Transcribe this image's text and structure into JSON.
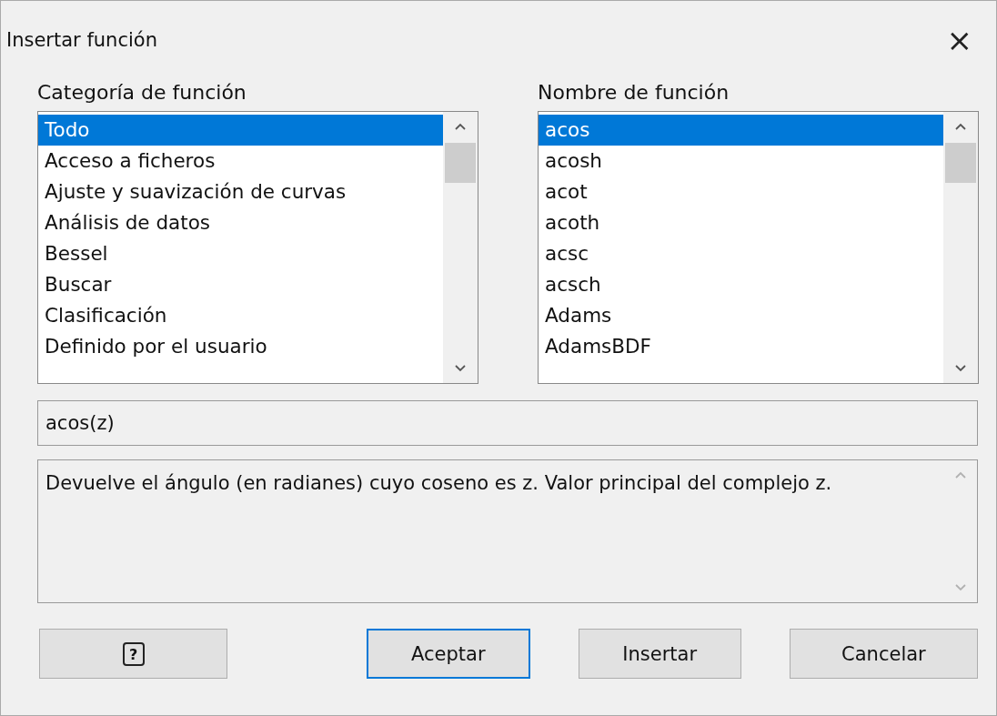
{
  "window": {
    "title": "Insertar función",
    "close": "×"
  },
  "category_list": {
    "label": "Categoría de función",
    "items": [
      {
        "label": "Todo",
        "selected": true
      },
      {
        "label": "Acceso a ficheros",
        "selected": false
      },
      {
        "label": "Ajuste y suavización de curvas",
        "selected": false
      },
      {
        "label": "Análisis de datos",
        "selected": false
      },
      {
        "label": "Bessel",
        "selected": false
      },
      {
        "label": "Buscar",
        "selected": false
      },
      {
        "label": "Clasificación",
        "selected": false
      },
      {
        "label": "Definido por el usuario",
        "selected": false
      }
    ]
  },
  "function_list": {
    "label": "Nombre de función",
    "items": [
      {
        "label": "acos",
        "selected": true
      },
      {
        "label": "acosh",
        "selected": false
      },
      {
        "label": "acot",
        "selected": false
      },
      {
        "label": "acoth",
        "selected": false
      },
      {
        "label": "acsc",
        "selected": false
      },
      {
        "label": "acsch",
        "selected": false
      },
      {
        "label": "Adams",
        "selected": false
      },
      {
        "label": "AdamsBDF",
        "selected": false
      }
    ]
  },
  "syntax": "acos(z)",
  "description": "Devuelve el ángulo (en radianes) cuyo coseno es z. Valor principal del complejo z.",
  "buttons": [
    {
      "kind": "help",
      "label": "?"
    },
    {
      "kind": "default",
      "label": "Aceptar"
    },
    {
      "kind": "normal",
      "label": "Insertar"
    },
    {
      "kind": "normal",
      "label": "Cancelar"
    }
  ]
}
